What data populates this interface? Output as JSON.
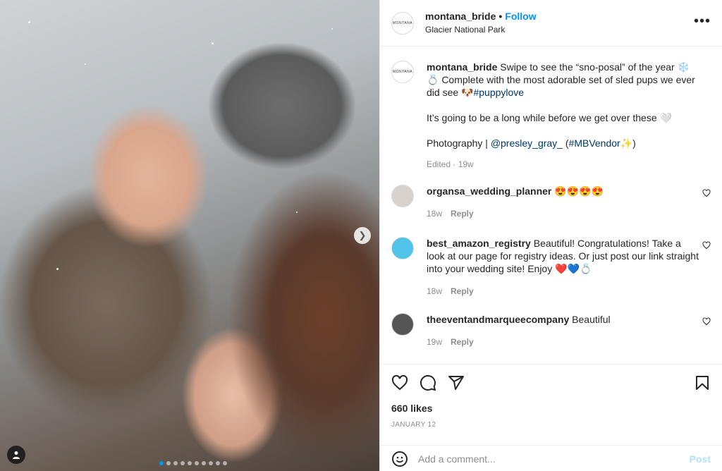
{
  "post": {
    "username": "montana_bride",
    "follow_label": "Follow",
    "location": "Glacier National Park",
    "avatar_text": "MONTANA",
    "caption": {
      "line1": " Swipe to see the “sno-posal” of the year ❄️💍 Complete with the most adorable set of sled pups we ever did see 🐶",
      "hashtag": "#puppylove",
      "line2": "It’s going to be a long while before we get over these 🤍",
      "photo_prefix": "Photography | ",
      "photographer": "@presley_gray_",
      "vendor_open": " (",
      "vendor_tag": "#MBVendor",
      "vendor_close": "✨)",
      "meta": "Edited · 19w"
    },
    "likes": "660 likes",
    "date": "JANUARY 12",
    "add_comment_placeholder": "Add a comment...",
    "post_label": "Post"
  },
  "comments": [
    {
      "user": "organsa_wedding_planner",
      "text": " 😍😍😍😍",
      "time": "18w",
      "reply": "Reply"
    },
    {
      "user": "best_amazon_registry",
      "text": " Beautiful! Congratulations! Take a look at our page for registry ideas. Or just post our link straight into your wedding site! Enjoy ❤️💙💍",
      "time": "18w",
      "reply": "Reply"
    },
    {
      "user": "theeventandmarqueecompany",
      "text": " Beautiful",
      "time": "19w",
      "reply": "Reply"
    }
  ],
  "colors": {
    "accent": "#0095f6",
    "muted": "#8e8e8e",
    "link": "#00376b",
    "post_disabled": "#b2dffc"
  },
  "icons": [
    "more-icon",
    "heart-icon",
    "comment-icon",
    "share-icon",
    "bookmark-icon",
    "emoji-icon",
    "chevron-right-icon",
    "user-tag-icon"
  ]
}
